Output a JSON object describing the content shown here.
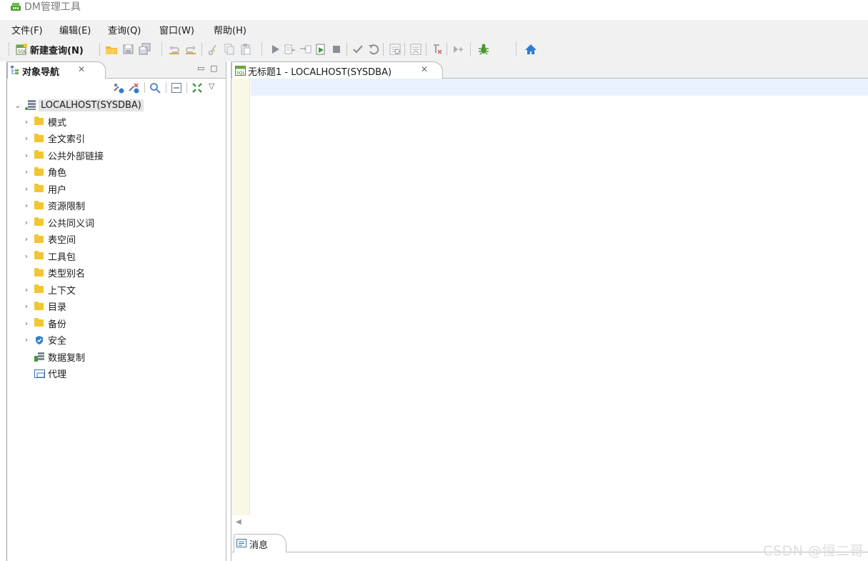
{
  "window": {
    "title": "DM管理工具"
  },
  "menu": [
    "文件(F)",
    "编辑(E)",
    "查询(Q)",
    "窗口(W)",
    "帮助(H)"
  ],
  "toolbar": {
    "new_query_label": "新建查询(N)"
  },
  "navigator": {
    "tab_label": "对象导航",
    "close_glyph": "✕",
    "minimize_glyph": "▭",
    "maximize_glyph": "□",
    "menu_glyph": "▽",
    "root_label": "LOCALHOST(SYSDBA)",
    "items": [
      {
        "label": "模式",
        "icon": "folder-icon",
        "expandable": true
      },
      {
        "label": "全文索引",
        "icon": "folder-icon",
        "expandable": true
      },
      {
        "label": "公共外部链接",
        "icon": "folder-icon",
        "expandable": true
      },
      {
        "label": "角色",
        "icon": "folder-icon",
        "expandable": true
      },
      {
        "label": "用户",
        "icon": "folder-icon",
        "expandable": true
      },
      {
        "label": "资源限制",
        "icon": "folder-icon",
        "expandable": true
      },
      {
        "label": "公共同义词",
        "icon": "folder-icon",
        "expandable": true
      },
      {
        "label": "表空间",
        "icon": "folder-icon",
        "expandable": true
      },
      {
        "label": "工具包",
        "icon": "folder-icon",
        "expandable": true
      },
      {
        "label": "类型别名",
        "icon": "folder-icon",
        "expandable": false
      },
      {
        "label": "上下文",
        "icon": "folder-icon",
        "expandable": true
      },
      {
        "label": "目录",
        "icon": "folder-icon",
        "expandable": true
      },
      {
        "label": "备份",
        "icon": "folder-icon",
        "expandable": true
      },
      {
        "label": "安全",
        "icon": "shield-icon",
        "expandable": true
      },
      {
        "label": "数据复制",
        "icon": "replication-icon",
        "expandable": false
      },
      {
        "label": "代理",
        "icon": "agent-icon",
        "expandable": false
      }
    ]
  },
  "editor": {
    "tab_label": "无标题1 - LOCALHOST(SYSDBA)",
    "close_glyph": "✕",
    "scroll_left_glyph": "◀"
  },
  "messages": {
    "tab_label": "消息"
  },
  "watermark": "CSDN @恒二哥",
  "colors": {
    "folder": "#f2c533",
    "current_line": "#e8f2fe",
    "gutter": "#fbf7e6",
    "chrome": "#f1f1f1"
  }
}
